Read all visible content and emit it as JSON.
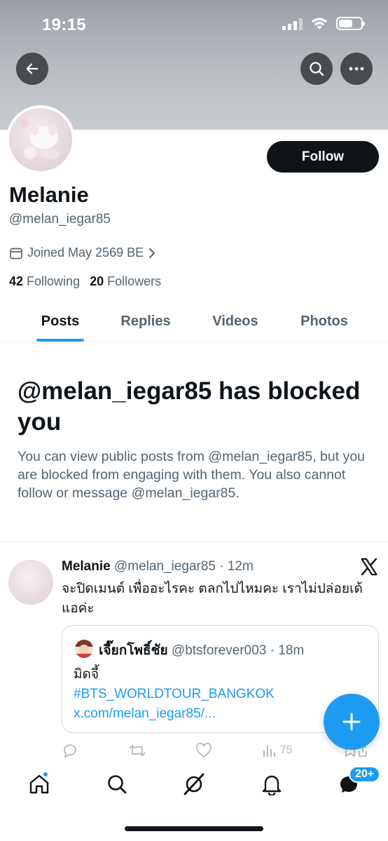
{
  "status_bar": {
    "time": "19:15"
  },
  "header": {
    "back_icon": "arrow-left-icon",
    "search_icon": "search-icon",
    "more_icon": "more-horizontal-icon"
  },
  "profile": {
    "name": "Melanie",
    "handle": "@melan_iegar85",
    "joined": "Joined May 2569 BE",
    "following_count": "42",
    "following_label": "Following",
    "followers_count": "20",
    "followers_label": "Followers",
    "follow_button": "Follow"
  },
  "tabs": [
    {
      "label": "Posts",
      "active": true
    },
    {
      "label": "Replies",
      "active": false
    },
    {
      "label": "Videos",
      "active": false
    },
    {
      "label": "Photos",
      "active": false
    }
  ],
  "blocked": {
    "title": "@melan_iegar85 has blocked you",
    "description": "You can view public posts from @melan_iegar85, but you are blocked from engaging with them. You also cannot follow or message @melan_iegar85."
  },
  "post": {
    "author_name": "Melanie",
    "author_meta": "@melan_iegar85 · 12m",
    "text": "จะปิดเมนต์ เพื่ออะไรคะ ตลกไปไหมคะ เราไม่ปล่อยเด้แอค่ะ",
    "quote": {
      "author_name": "เจี๊ยกโพธิ์ชัย",
      "author_meta": "@btsforever003 · 18m",
      "text": "มิดจี้",
      "link": "#BTS_WORLDTOUR_BANGKOK x.com/melan_iegar85/..."
    },
    "views": "75"
  },
  "bottom_nav": {
    "items": [
      "home-icon",
      "search-icon",
      "grok-icon",
      "notifications-icon",
      "messages-icon"
    ],
    "messages_badge": "20+"
  },
  "colors": {
    "accent": "#1d9bf0",
    "text": "#0f1419",
    "muted": "#536471",
    "border": "#cfd9de"
  }
}
